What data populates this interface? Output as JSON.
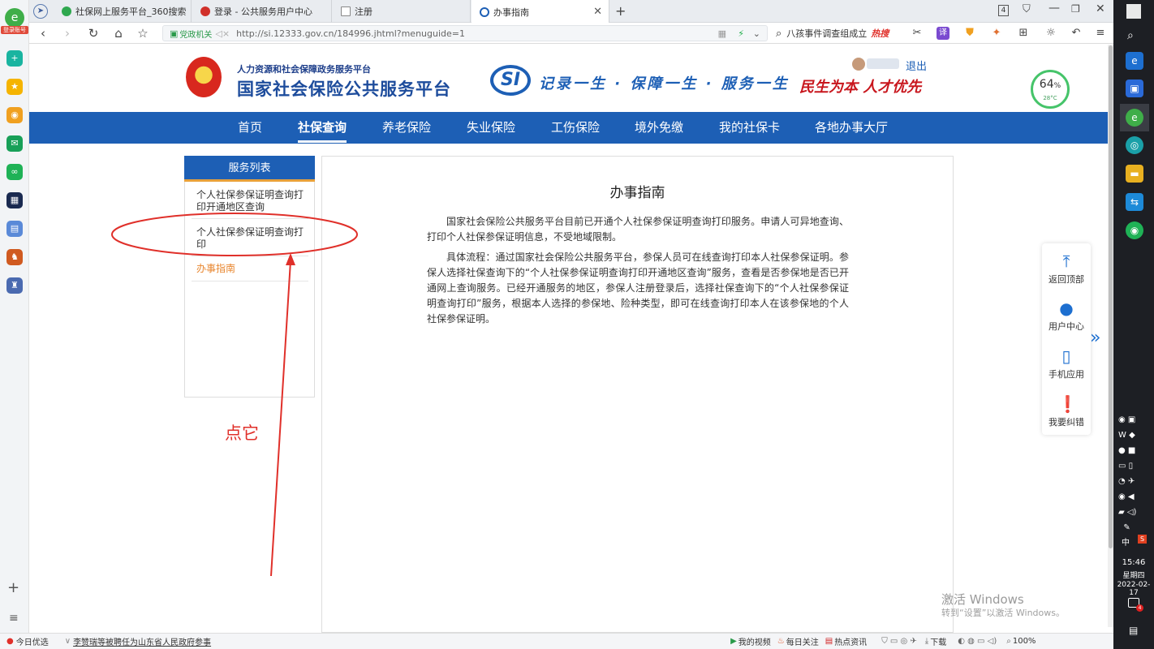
{
  "browser": {
    "tabs": [
      {
        "label": "社保网上服务平台_360搜索",
        "active": false
      },
      {
        "label": "登录 - 公共服务用户中心",
        "active": false
      },
      {
        "label": "注册",
        "active": false
      },
      {
        "label": "办事指南",
        "active": true
      }
    ],
    "new_tab": "+",
    "tab_count": "4",
    "url_badge": "党政机关",
    "url": "http://si.12333.gov.cn/184996.jhtml?menuguide=1",
    "search_text": "八孩事件调查组成立",
    "hot_search": "热搜",
    "sidebar_account_label": "登录账号"
  },
  "site": {
    "ministry": "人力资源和社会保障政务服务平台",
    "platform_name": "国家社会保险公共服务平台",
    "si_logo": "SI",
    "slogan": "记录一生 · 保障一生 · 服务一生",
    "slogan2": "民生为本 人才优先",
    "logout": "退出",
    "gauge_percent": "64",
    "gauge_percent_sign": "%",
    "gauge_temp": "28°C"
  },
  "nav": {
    "items": [
      "首页",
      "社保查询",
      "养老保险",
      "失业保险",
      "工伤保险",
      "境外免缴",
      "我的社保卡",
      "各地办事大厅"
    ],
    "active_index": 1
  },
  "service_list": {
    "header": "服务列表",
    "items": [
      "个人社保参保证明查询打印开通地区查询",
      "个人社保参保证明查询打印",
      "办事指南"
    ],
    "active_index": 2
  },
  "content": {
    "title": "办事指南",
    "paragraph1": "国家社会保险公共服务平台目前已开通个人社保参保证明查询打印服务。申请人可异地查询、打印个人社保参保证明信息，不受地域限制。",
    "paragraph2": "具体流程：通过国家社会保险公共服务平台，参保人员可在线查询打印本人社保参保证明。参保人选择社保查询下的“个人社保参保证明查询打印开通地区查询”服务，查看是否参保地是否已开通网上查询服务。已经开通服务的地区，参保人注册登录后，选择社保查询下的“个人社保参保证明查询打印”服务，根据本人选择的参保地、险种类型，即可在线查询打印本人在该参保地的个人社保参保证明。"
  },
  "float_tools": [
    "返回顶部",
    "用户中心",
    "手机应用",
    "我要纠错"
  ],
  "annotation": {
    "hint": "点它",
    "color": "#e0302a"
  },
  "watermark": {
    "line1": "激活 Windows",
    "line2": "转到“设置”以激活 Windows。"
  },
  "statusbar": {
    "left_item": "今日优选",
    "news": "李赞瑞等被聘任为山东省人民政府参事",
    "video": "我的视频",
    "daily": "每日关注",
    "hot": "热点资讯",
    "download": "下载",
    "zoom": "100%"
  },
  "taskbar": {
    "ime": "中",
    "time": "15:46",
    "weekday": "星期四",
    "date": "2022-02-17",
    "notif": "4"
  },
  "colors": {
    "brand_blue": "#1d5fb5",
    "accent_orange": "#e8852d",
    "annotation_red": "#e0302a"
  }
}
